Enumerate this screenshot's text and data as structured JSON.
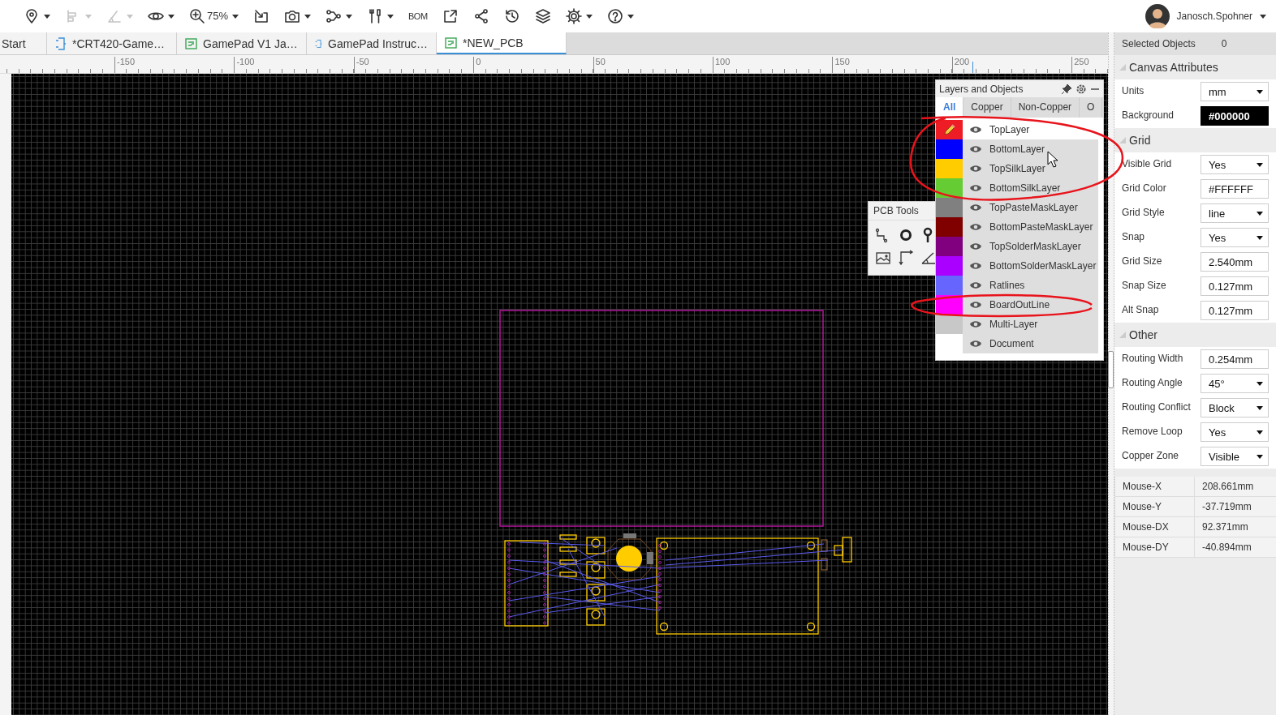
{
  "toolbar": {
    "items": [
      {
        "kind": "pin",
        "disabled": false,
        "menu": true
      },
      {
        "kind": "align",
        "disabled": true,
        "menu": true
      },
      {
        "kind": "measure",
        "disabled": true,
        "menu": true
      },
      {
        "kind": "view",
        "disabled": false,
        "menu": true
      },
      {
        "kind": "zoom",
        "label": "75%",
        "disabled": false,
        "menu": true
      },
      {
        "kind": "import",
        "disabled": false,
        "menu": false
      },
      {
        "kind": "camera",
        "disabled": false,
        "menu": true
      },
      {
        "kind": "network",
        "disabled": false,
        "menu": true
      },
      {
        "kind": "tools",
        "disabled": false,
        "menu": true
      },
      {
        "kind": "text",
        "label": "BOM",
        "disabled": false,
        "menu": false
      },
      {
        "kind": "export",
        "disabled": false,
        "menu": false
      },
      {
        "kind": "share",
        "disabled": false,
        "menu": false
      },
      {
        "kind": "history",
        "disabled": false,
        "menu": false
      },
      {
        "kind": "layers",
        "disabled": false,
        "menu": false
      },
      {
        "kind": "settings",
        "disabled": false,
        "menu": true
      },
      {
        "kind": "help",
        "disabled": false,
        "menu": true
      }
    ],
    "user": {
      "name": "Janosch.Spohner"
    }
  },
  "doc_tabs": [
    {
      "label": "Start",
      "kind": "home",
      "selected": false
    },
    {
      "label": "*CRT420-Game…",
      "kind": "schematic",
      "selected": false
    },
    {
      "label": "GamePad V1 Ja…",
      "kind": "pcb",
      "selected": false
    },
    {
      "label": "GamePad Instruc…",
      "kind": "schematic",
      "selected": false
    },
    {
      "label": "*NEW_PCB",
      "kind": "pcb",
      "selected": true
    }
  ],
  "ruler": {
    "labels": [
      "-150",
      "-100",
      "-50",
      "0",
      "50",
      "100",
      "150",
      "200",
      "250"
    ]
  },
  "layers_panel": {
    "title": "Layers and Objects",
    "tabs": [
      {
        "label": "All",
        "selected": true
      },
      {
        "label": "Copper",
        "selected": false
      },
      {
        "label": "Non-Copper",
        "selected": false
      },
      {
        "label": "O",
        "selected": false
      }
    ],
    "layers": [
      {
        "name": "TopLayer",
        "color": "#ee1c24",
        "visible": true,
        "selected": true
      },
      {
        "name": "BottomLayer",
        "color": "#0000ff",
        "visible": true,
        "selected": false
      },
      {
        "name": "TopSilkLayer",
        "color": "#ffcc00",
        "visible": true,
        "selected": false
      },
      {
        "name": "BottomSilkLayer",
        "color": "#66cc33",
        "visible": true,
        "selected": false
      },
      {
        "name": "TopPasteMaskLayer",
        "color": "#808080",
        "visible": true,
        "selected": false
      },
      {
        "name": "BottomPasteMaskLayer",
        "color": "#800000",
        "visible": true,
        "selected": false
      },
      {
        "name": "TopSolderMaskLayer",
        "color": "#800080",
        "visible": true,
        "selected": false
      },
      {
        "name": "BottomSolderMaskLayer",
        "color": "#aa00ff",
        "visible": true,
        "selected": false
      },
      {
        "name": "Ratlines",
        "color": "#6666ff",
        "visible": true,
        "selected": false
      },
      {
        "name": "BoardOutLine",
        "color": "#ff00ff",
        "visible": true,
        "selected": false
      },
      {
        "name": "Multi-Layer",
        "color": "#c8c8c8",
        "visible": true,
        "selected": false
      },
      {
        "name": "Document",
        "color": "#ffffff",
        "visible": true,
        "selected": false
      }
    ]
  },
  "pcb_tools": {
    "title": "PCB Tools"
  },
  "properties": {
    "selected_objects": {
      "label": "Selected Objects",
      "value": "0"
    },
    "sections": [
      {
        "title": "Canvas Attributes",
        "expanded": true,
        "rows": [
          {
            "label": "Units",
            "kind": "select",
            "value": "mm"
          },
          {
            "label": "Background",
            "kind": "color",
            "value": "#000000"
          }
        ]
      },
      {
        "title": "Grid",
        "expanded": true,
        "rows": [
          {
            "label": "Visible Grid",
            "kind": "select",
            "value": "Yes"
          },
          {
            "label": "Grid Color",
            "kind": "input",
            "value": "#FFFFFF"
          },
          {
            "label": "Grid Style",
            "kind": "select",
            "value": "line"
          },
          {
            "label": "Snap",
            "kind": "select",
            "value": "Yes"
          },
          {
            "label": "Grid Size",
            "kind": "input",
            "value": "2.540mm"
          },
          {
            "label": "Snap Size",
            "kind": "input",
            "value": "0.127mm"
          },
          {
            "label": "Alt Snap",
            "kind": "input",
            "value": "0.127mm"
          }
        ]
      },
      {
        "title": "Other",
        "expanded": true,
        "rows": [
          {
            "label": "Routing Width",
            "kind": "input",
            "value": "0.254mm"
          },
          {
            "label": "Routing Angle",
            "kind": "select",
            "value": "45°"
          },
          {
            "label": "Routing Conflict",
            "kind": "select",
            "value": "Block"
          },
          {
            "label": "Remove Loop",
            "kind": "select",
            "value": "Yes"
          },
          {
            "label": "Copper Zone",
            "kind": "select",
            "value": "Visible"
          }
        ]
      }
    ],
    "mouse": [
      {
        "label": "Mouse-X",
        "value": "208.661mm"
      },
      {
        "label": "Mouse-Y",
        "value": "-37.719mm"
      },
      {
        "label": "Mouse-DX",
        "value": "92.371mm"
      },
      {
        "label": "Mouse-DY",
        "value": "-40.894mm"
      }
    ]
  }
}
